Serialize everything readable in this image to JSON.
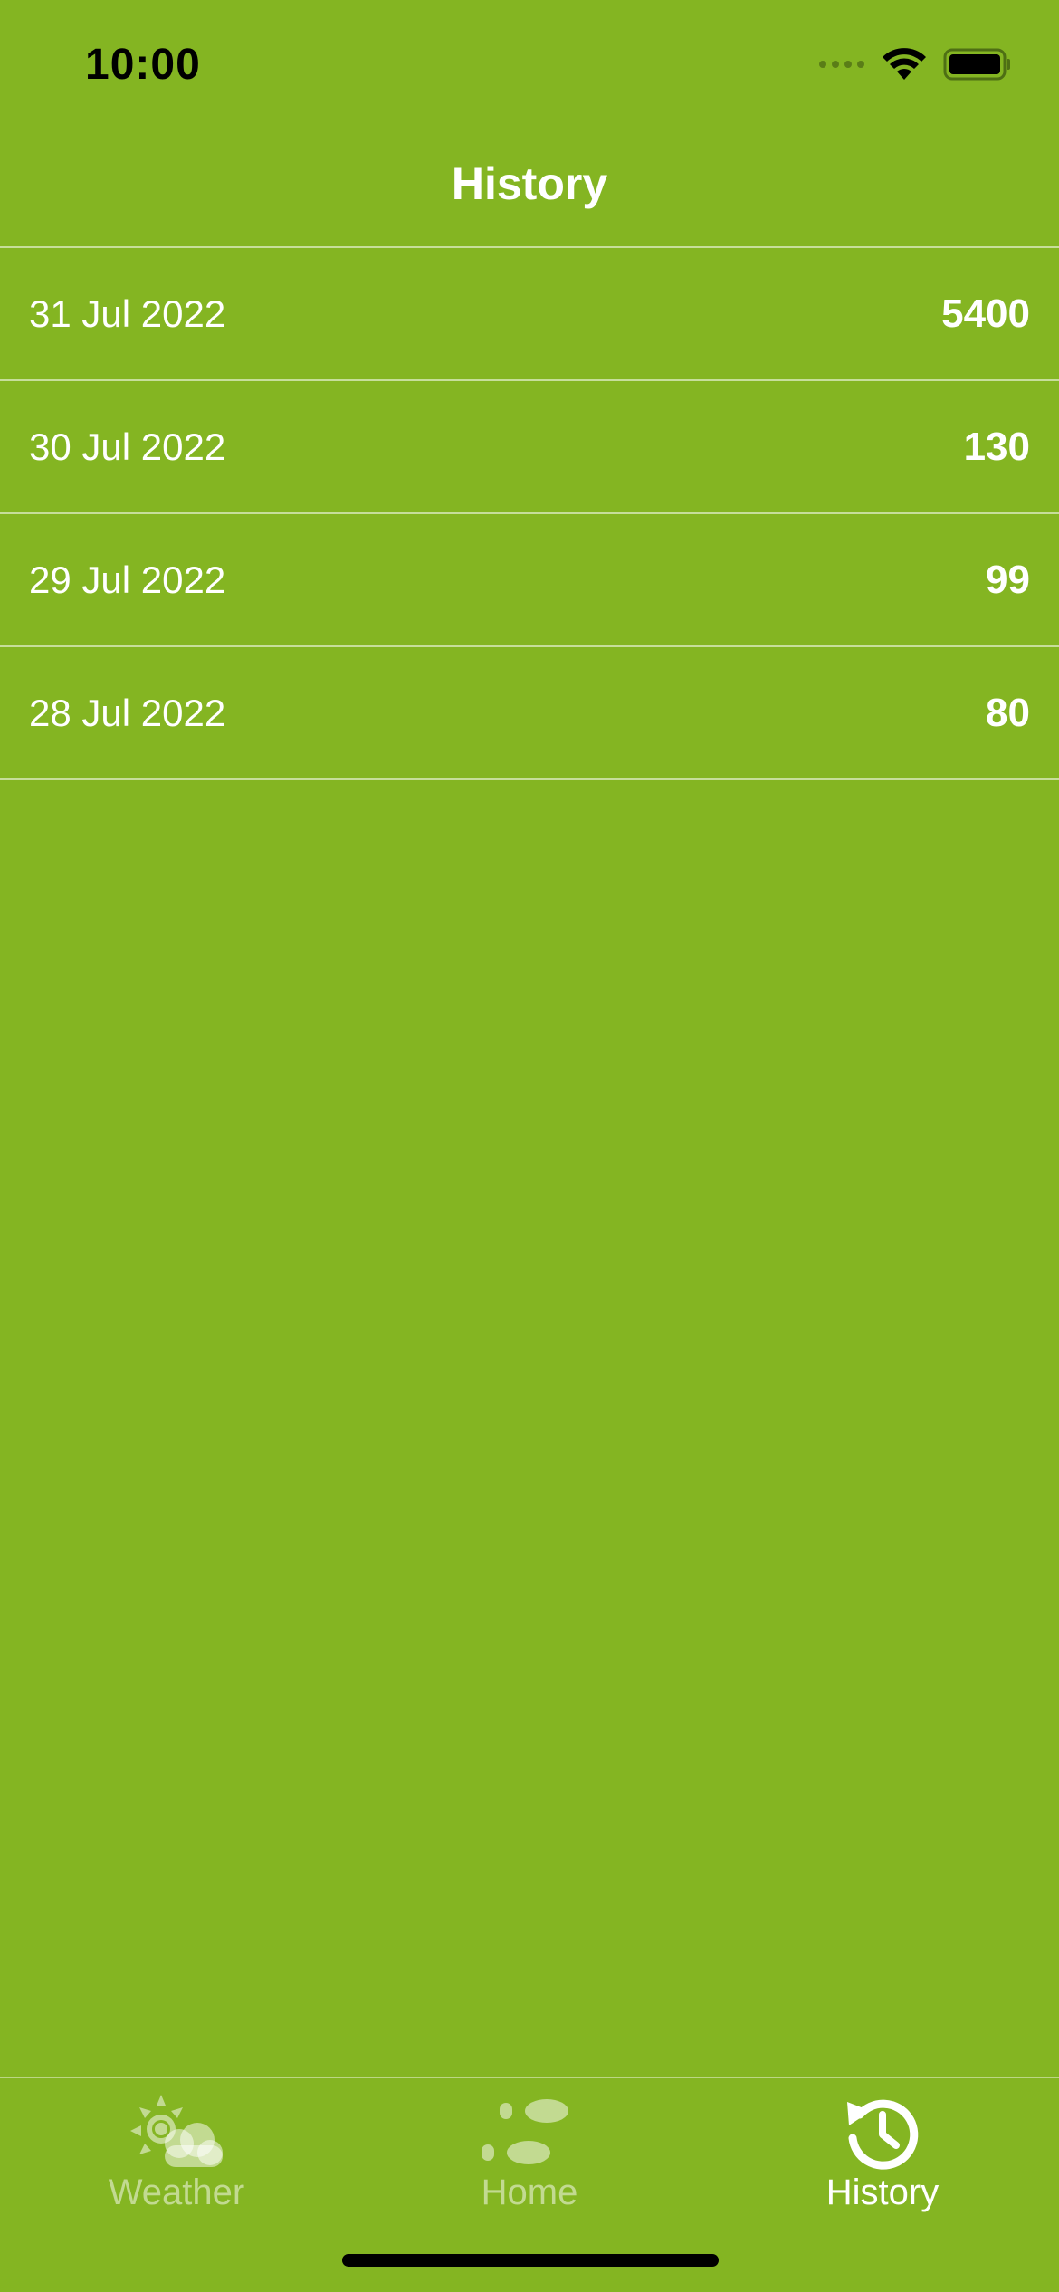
{
  "status_bar": {
    "time": "10:00"
  },
  "nav": {
    "title": "History"
  },
  "history": [
    {
      "date": "31 Jul 2022",
      "value": "5400"
    },
    {
      "date": "30 Jul 2022",
      "value": "130"
    },
    {
      "date": "29 Jul 2022",
      "value": "99"
    },
    {
      "date": "28 Jul 2022",
      "value": "80"
    }
  ],
  "tabs": [
    {
      "label": "Weather",
      "icon": "weather-icon",
      "active": false
    },
    {
      "label": "Home",
      "icon": "footprints-icon",
      "active": false
    },
    {
      "label": "History",
      "icon": "history-icon",
      "active": true
    }
  ],
  "colors": {
    "background": "#84b522",
    "text": "#ffffff"
  }
}
